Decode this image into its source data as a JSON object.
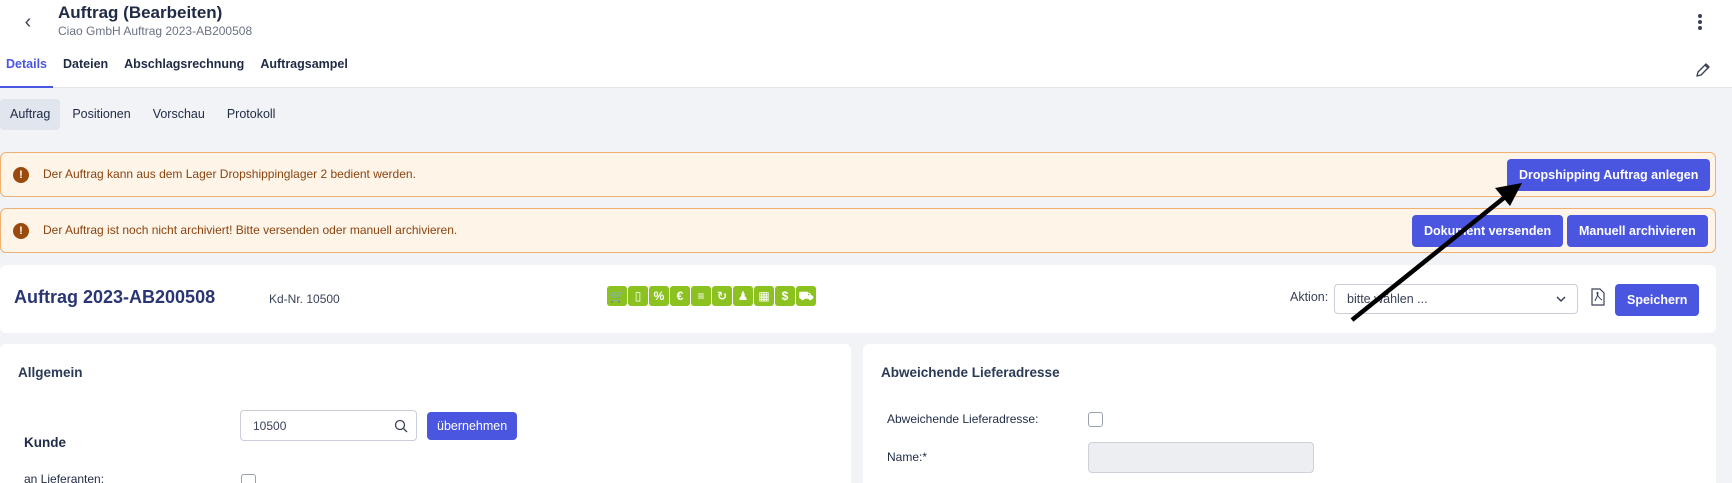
{
  "header": {
    "title": "Auftrag (Bearbeiten)",
    "subtitle": "Ciao GmbH Auftrag 2023-AB200508",
    "back_icon": "chevron-left-icon",
    "menu_icon": "more-vertical-icon",
    "edit_icon": "pencil-icon"
  },
  "main_tabs": [
    {
      "label": "Details",
      "active": true
    },
    {
      "label": "Dateien",
      "active": false
    },
    {
      "label": "Abschlagsrechnung",
      "active": false
    },
    {
      "label": "Auftragsampel",
      "active": false
    }
  ],
  "sub_tabs": [
    {
      "label": "Auftrag",
      "active": true
    },
    {
      "label": "Positionen",
      "active": false
    },
    {
      "label": "Vorschau",
      "active": false
    },
    {
      "label": "Protokoll",
      "active": false
    }
  ],
  "alerts": [
    {
      "text": "Der Auftrag kann aus dem Lager Dropshippinglager 2 bedient werden.",
      "buttons": [
        "Dropshipping Auftrag anlegen"
      ]
    },
    {
      "text": "Der Auftrag ist noch nicht archiviert! Bitte versenden oder manuell archivieren.",
      "buttons": [
        "Dokument versenden",
        "Manuell archivieren"
      ]
    }
  ],
  "order": {
    "title": "Auftrag 2023-AB200508",
    "kd_nr": "Kd-Nr. 10500",
    "status_icons": [
      "cart-icon",
      "mobile-icon",
      "percent-icon",
      "euro-icon",
      "document-icon",
      "refresh-icon",
      "person-icon",
      "calendar-icon",
      "dollar-icon",
      "truck-icon"
    ],
    "status_icon_glyphs": [
      "🛒",
      "▯",
      "%",
      "€",
      "≡",
      "↻",
      "♟",
      "▦",
      "$",
      "⛟"
    ],
    "aktion_label": "Aktion:",
    "aktion_value": "bitte wählen ...",
    "save_label": "Speichern"
  },
  "panel_left": {
    "title": "Allgemein",
    "kunde_label": "Kunde",
    "search_value": "10500",
    "apply_label": "übernehmen",
    "lieferanten_label": "an Lieferanten:"
  },
  "panel_right": {
    "title": "Abweichende Lieferadresse",
    "checkbox_label": "Abweichende Lieferadresse:",
    "name_label": "Name:*"
  },
  "colors": {
    "primary": "#4a55e0",
    "alert_bg": "#fff4e8",
    "alert_border": "#f0b074",
    "status_green": "#8cc220"
  }
}
